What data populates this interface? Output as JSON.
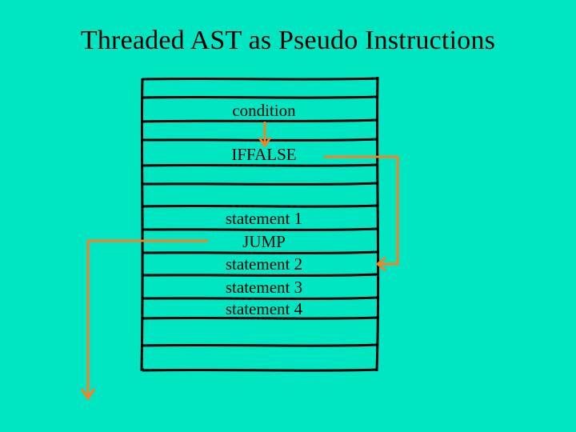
{
  "title": "Threaded AST as Pseudo Instructions",
  "rows": {
    "condition": "condition",
    "iffalse": "IFFALSE",
    "stmt1": "statement 1",
    "jump": "JUMP",
    "stmt2": "statement 2",
    "stmt3": "statement 3",
    "stmt4": "statement 4"
  },
  "colors": {
    "background": "#00e6c2",
    "ink": "#000000",
    "arrow": "#ff7d1f"
  }
}
